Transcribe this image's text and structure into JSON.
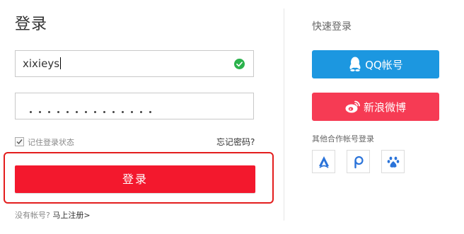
{
  "login": {
    "title": "登录",
    "username_value": "xixieys",
    "password_masked_count": 14,
    "remember_label": "记住登录状态",
    "forgot_label": "忘记密码?",
    "submit_label": "登录",
    "no_account_label": "没有帐号?",
    "register_label": "马上注册>"
  },
  "quick": {
    "title": "快速登录",
    "qq_label": "QQ帐号",
    "weibo_label": "新浪微博",
    "partner_title": "其他合作帐号登录",
    "partners": [
      "partner-a-icon",
      "partner-p-icon",
      "baidu-paw-icon"
    ]
  },
  "colors": {
    "submit": "#f3182d",
    "highlight_outline": "#e31d1d",
    "qq": "#1c97e0",
    "weibo": "#f63b54",
    "valid": "#2bb24c",
    "partner_icon": "#2a73d9"
  }
}
